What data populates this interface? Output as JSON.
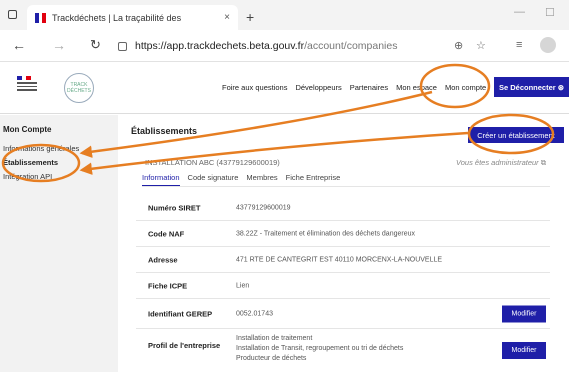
{
  "browser": {
    "tab_title": "Trackdéchets | La traçabilité des",
    "tab_close": "×",
    "new_tab": "+",
    "url_host": "https://app.trackdechets.beta.gouv.fr",
    "url_path": "/account/companies"
  },
  "header": {
    "nav": [
      "Foire aux questions",
      "Développeurs",
      "Partenaires",
      "Mon espace",
      "Mon compte"
    ],
    "logout_label": "Se Déconnecter",
    "logo_top": "TRACK",
    "logo_bottom": "DÉCHETS"
  },
  "sidebar": {
    "title": "Mon Compte",
    "items": [
      {
        "label": "Informations générales"
      },
      {
        "label": "Établissements"
      },
      {
        "label": "Intégration API"
      }
    ]
  },
  "main": {
    "title": "Établissements",
    "create_label": "Créer un établissement",
    "company_name": "INSTALLATION ABC (43779129600019)",
    "admin_note": "Vous êtes administrateur",
    "tabs": [
      "Information",
      "Code signature",
      "Membres",
      "Fiche Entreprise"
    ],
    "rows": [
      {
        "label": "Numéro SIRET",
        "value": "43779129600019"
      },
      {
        "label": "Code NAF",
        "value": "38.22Z - Traitement et élimination des déchets dangereux"
      },
      {
        "label": "Adresse",
        "value": "471 RTE DE CANTEGRIT EST 40110 MORCENX-LA-NOUVELLE"
      },
      {
        "label": "Fiche ICPE",
        "value": "Lien"
      },
      {
        "label": "Identifiant GEREP",
        "value": "0052.01743"
      },
      {
        "label": "Profil de l'entreprise",
        "values": [
          "Installation de traitement",
          "Installation de Transit, regroupement ou tri de déchets",
          "Producteur de déchets"
        ]
      }
    ],
    "modify_label": "Modifier"
  },
  "colors": {
    "primary": "#1f1fa8",
    "annotation": "#e67e22"
  }
}
